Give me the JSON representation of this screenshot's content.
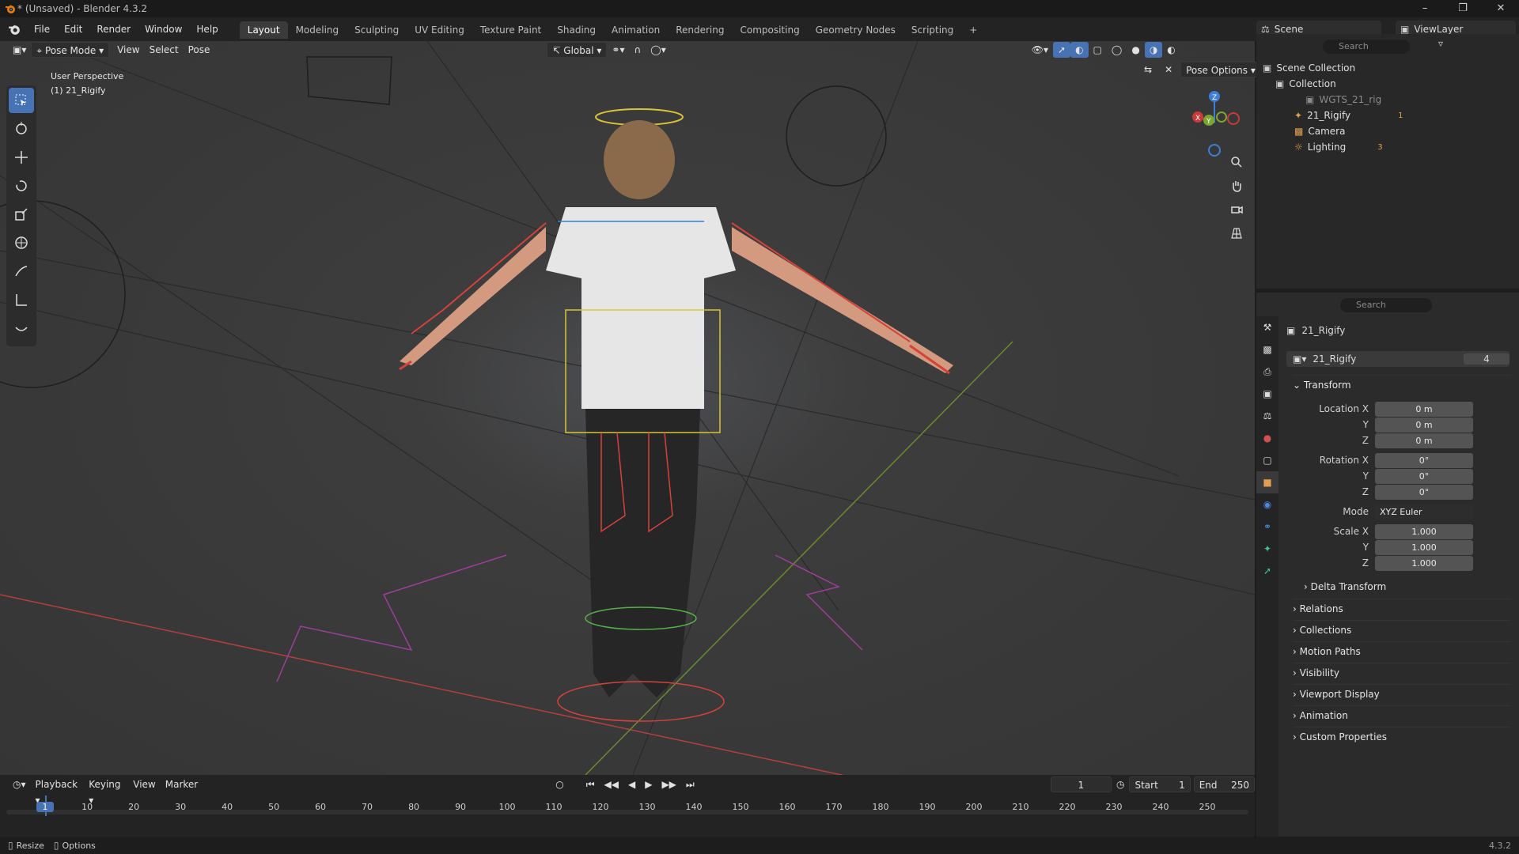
{
  "window": {
    "title": "* (Unsaved) - Blender 4.3.2"
  },
  "menu": {
    "items": [
      "File",
      "Edit",
      "Render",
      "Window",
      "Help"
    ]
  },
  "workspaces": [
    "Layout",
    "Modeling",
    "Sculpting",
    "UV Editing",
    "Texture Paint",
    "Shading",
    "Animation",
    "Rendering",
    "Compositing",
    "Geometry Nodes",
    "Scripting"
  ],
  "scene": {
    "name": "Scene",
    "view_layer": "ViewLayer"
  },
  "viewport": {
    "mode": "Pose Mode",
    "menus": [
      "View",
      "Select",
      "Pose"
    ],
    "orientation": "Global",
    "pose_options": "Pose Options",
    "overlay_view": "User Perspective",
    "overlay_object": "(1) 21_Rigify"
  },
  "outliner": {
    "search_placeholder": "Search",
    "root": "Scene Collection",
    "collection": "Collection",
    "items": [
      {
        "name": "WGTS_21_rig"
      },
      {
        "name": "21_Rigify",
        "badge": "1"
      },
      {
        "name": "Camera"
      },
      {
        "name": "Lighting",
        "badge": "3"
      }
    ]
  },
  "properties": {
    "search_placeholder": "Search",
    "object_name": "21_Rigify",
    "datablock": "21_Rigify",
    "users": "4",
    "transform_header": "Transform",
    "location": {
      "label": "Location X",
      "x": "0 m",
      "y": "0 m",
      "z": "0 m"
    },
    "rotation": {
      "label": "Rotation X",
      "x": "0°",
      "y": "0°",
      "z": "0°"
    },
    "mode": {
      "label": "Mode",
      "value": "XYZ Euler"
    },
    "scale": {
      "label": "Scale X",
      "x": "1.000",
      "y": "1.000",
      "z": "1.000"
    },
    "axis_y": "Y",
    "axis_z": "Z",
    "subpanels": [
      "Delta Transform",
      "Relations",
      "Collections",
      "Motion Paths",
      "Visibility",
      "Viewport Display",
      "Animation",
      "Custom Properties"
    ]
  },
  "timeline": {
    "menus": [
      "Playback",
      "Keying",
      "View",
      "Marker"
    ],
    "current_frame": "1",
    "start_label": "Start",
    "start": "1",
    "end_label": "End",
    "end": "250",
    "ticks": [
      "1",
      "10",
      "20",
      "30",
      "40",
      "50",
      "60",
      "70",
      "80",
      "90",
      "100",
      "110",
      "120",
      "130",
      "140",
      "150",
      "160",
      "170",
      "180",
      "190",
      "200",
      "210",
      "220",
      "230",
      "240",
      "250"
    ]
  },
  "status": {
    "left1": "Resize",
    "left2": "Options",
    "version": "4.3.2"
  },
  "colors": {
    "accent": "#4772b3",
    "header": "#232323",
    "viewport": "#3d3d3d",
    "panel": "#2b2b2b",
    "x_axis": "#c93a3a",
    "y_axis": "#7ba632",
    "z_axis": "#3e7ed6"
  }
}
